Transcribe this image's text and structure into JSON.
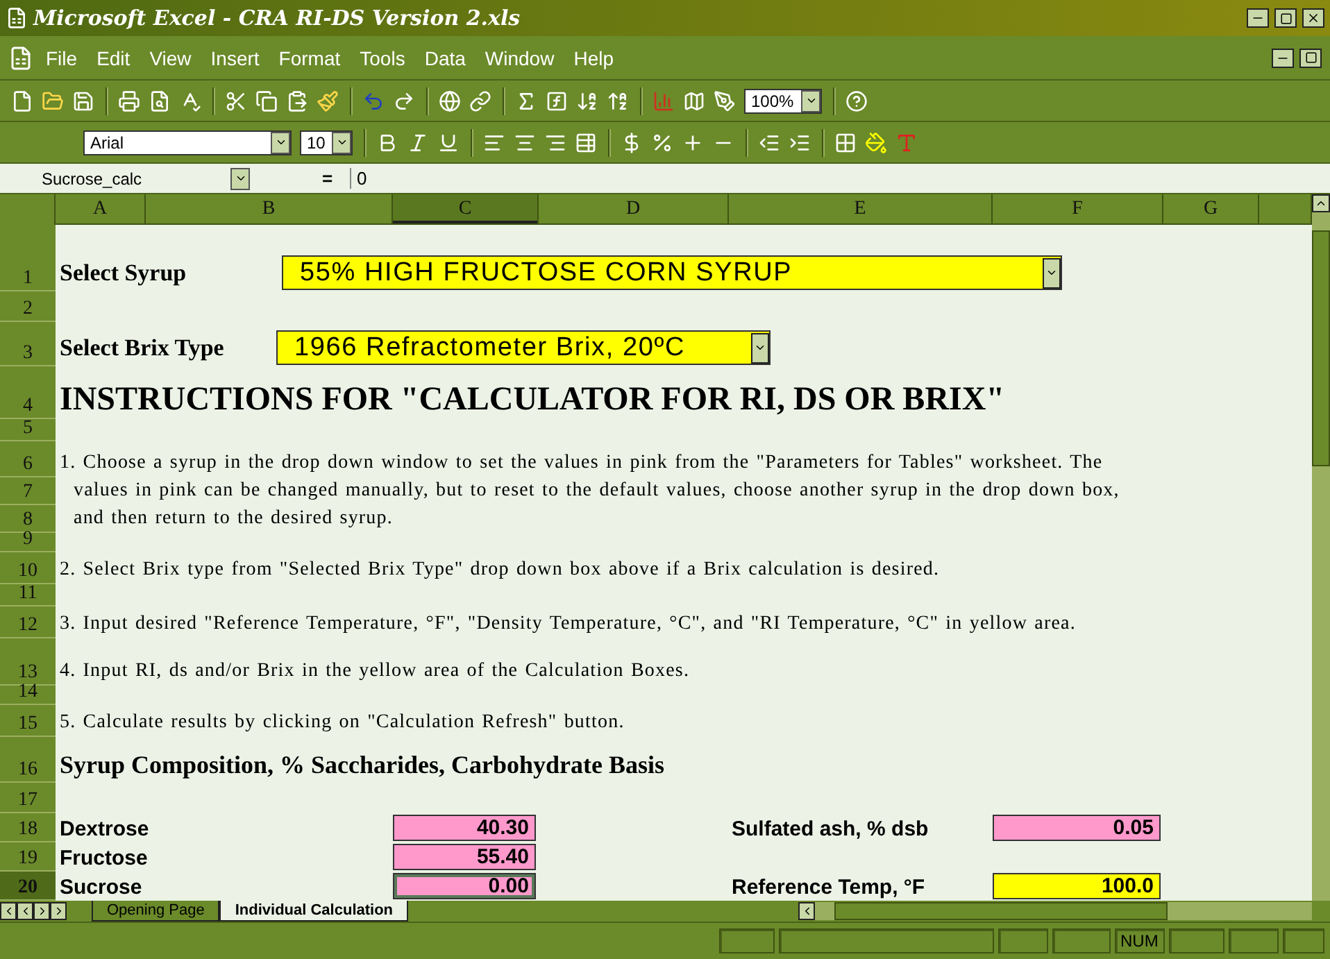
{
  "window": {
    "title": "Microsoft Excel - CRA RI-DS Version 2.xls"
  },
  "menu": [
    "File",
    "Edit",
    "View",
    "Insert",
    "Format",
    "Tools",
    "Data",
    "Window",
    "Help"
  ],
  "toolbar": {
    "zoom": "100%"
  },
  "format_toolbar": {
    "font": "Arial",
    "size": "10"
  },
  "formula_bar": {
    "name_box": "Sucrose_calc",
    "equals": "=",
    "value": "0"
  },
  "columns": [
    {
      "label": "A",
      "selected": false
    },
    {
      "label": "B",
      "selected": false
    },
    {
      "label": "C",
      "selected": true
    },
    {
      "label": "D",
      "selected": false
    },
    {
      "label": "E",
      "selected": false
    },
    {
      "label": "F",
      "selected": false
    },
    {
      "label": "G",
      "selected": false
    }
  ],
  "rows": [
    {
      "number": "1",
      "selected": false,
      "kind": "select",
      "label": "Select Syrup",
      "value": "55% HIGH FRUCTOSE CORN SYRUP"
    },
    {
      "number": "2",
      "selected": false,
      "kind": "empty"
    },
    {
      "number": "3",
      "selected": false,
      "kind": "select",
      "label": "Select Brix Type",
      "value": "1966 Refractometer Brix, 20ºC"
    },
    {
      "number": "4",
      "selected": false,
      "kind": "heading",
      "text": "INSTRUCTIONS FOR \"CALCULATOR FOR RI, DS OR BRIX\""
    },
    {
      "number": "5",
      "selected": false,
      "kind": "empty"
    },
    {
      "number": "6",
      "selected": false,
      "kind": "text",
      "continued": false,
      "text": "1. Choose a syrup in the drop down window to set the values in pink from the \"Parameters for Tables\" worksheet. The"
    },
    {
      "number": "7",
      "selected": false,
      "kind": "text",
      "continued": true,
      "text": "values in pink can be changed manually, but to reset to the default values, choose another syrup in the drop down box,"
    },
    {
      "number": "8",
      "selected": false,
      "kind": "text",
      "continued": true,
      "text": "and then return to the desired syrup."
    },
    {
      "number": "9",
      "selected": false,
      "kind": "empty"
    },
    {
      "number": "10",
      "selected": false,
      "kind": "text",
      "continued": false,
      "text": "2. Select Brix type from \"Selected Brix Type\" drop down box above if a Brix calculation is desired."
    },
    {
      "number": "11",
      "selected": false,
      "kind": "empty"
    },
    {
      "number": "12",
      "selected": false,
      "kind": "text",
      "continued": false,
      "text": "3. Input desired \"Reference Temperature, °F\", \"Density Temperature, °C\", and \"RI Temperature, °C\" in yellow area."
    },
    {
      "number": "13",
      "selected": false,
      "kind": "text",
      "continued": false,
      "text": "4. Input RI, ds and/or Brix in the yellow area of the Calculation Boxes."
    },
    {
      "number": "14",
      "selected": false,
      "kind": "empty"
    },
    {
      "number": "15",
      "selected": false,
      "kind": "text",
      "continued": false,
      "text": "5. Calculate results by clicking on \"Calculation Refresh\" button."
    },
    {
      "number": "16",
      "selected": false,
      "kind": "section",
      "text": "Syrup Composition, % Saccharides, Carbohydrate Basis"
    },
    {
      "number": "17",
      "selected": false,
      "kind": "empty"
    },
    {
      "number": "18",
      "selected": false,
      "kind": "data",
      "items": [
        {
          "label": "Dextrose",
          "value": "40.30",
          "color": "#ff99cc",
          "active": false
        },
        {
          "label": "Sulfated ash, % dsb",
          "value": "0.05",
          "color": "#ff99cc",
          "active": false
        }
      ]
    },
    {
      "number": "19",
      "selected": false,
      "kind": "data",
      "items": [
        {
          "label": "Fructose",
          "value": "55.40",
          "color": "#ff99cc",
          "active": false
        }
      ]
    },
    {
      "number": "20",
      "selected": true,
      "kind": "data",
      "items": [
        {
          "label": "Sucrose",
          "value": "0.00",
          "color": "#ff99cc",
          "active": true
        },
        {
          "label": "Reference Temp, °F",
          "value": "100.0",
          "color": "#ffff00",
          "active": false
        }
      ]
    }
  ],
  "sheet_tabs": [
    {
      "label": "Opening Page",
      "selected": false
    },
    {
      "label": "Individual Calculation",
      "selected": true
    }
  ],
  "status_bar": {
    "num": "NUM"
  }
}
